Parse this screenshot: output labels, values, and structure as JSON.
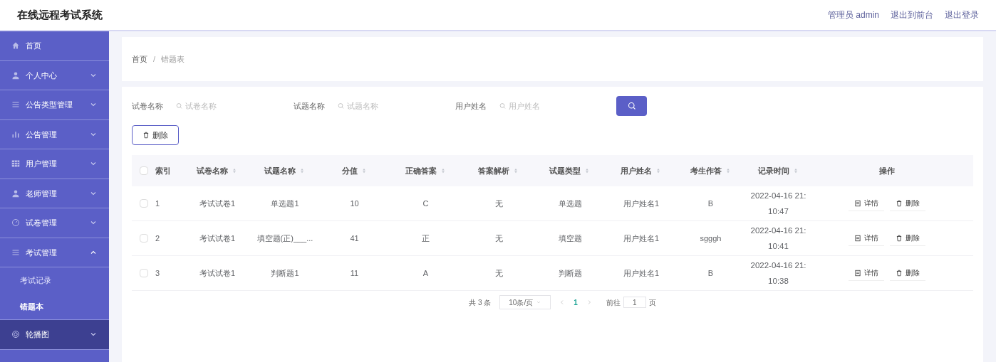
{
  "header": {
    "title": "在线远程考试系统",
    "links": [
      "管理员 admin",
      "退出到前台",
      "退出登录"
    ]
  },
  "sidebar": {
    "items": [
      {
        "label": "首页",
        "kind": "link",
        "selected": false
      },
      {
        "label": "个人中心",
        "kind": "menu",
        "expanded": false,
        "selected": false
      },
      {
        "label": "公告类型管理",
        "kind": "menu",
        "expanded": false,
        "selected": false
      },
      {
        "label": "公告管理",
        "kind": "menu",
        "expanded": false,
        "selected": false
      },
      {
        "label": "用户管理",
        "kind": "menu",
        "expanded": false,
        "selected": false
      },
      {
        "label": "老师管理",
        "kind": "menu",
        "expanded": false,
        "selected": false
      },
      {
        "label": "试卷管理",
        "kind": "menu",
        "expanded": false,
        "selected": false
      },
      {
        "label": "考试管理",
        "kind": "menu",
        "expanded": true,
        "selected": false,
        "children": [
          {
            "label": "考试记录",
            "selected": false
          },
          {
            "label": "错题本",
            "selected": true
          }
        ]
      },
      {
        "label": "轮播图",
        "kind": "menu",
        "expanded": false,
        "selected": true
      }
    ]
  },
  "breadcrumb": {
    "items": [
      "首页",
      "错题表"
    ],
    "separator": "/"
  },
  "search": {
    "fields": [
      {
        "label": "试卷名称",
        "placeholder": "试卷名称"
      },
      {
        "label": "试题名称",
        "placeholder": "试题名称"
      },
      {
        "label": "用户姓名",
        "placeholder": "用户姓名"
      }
    ]
  },
  "delete_button": "删除",
  "table": {
    "all_checked": false,
    "columns": [
      {
        "label": "索引",
        "sortable": false
      },
      {
        "label": "试卷名称",
        "sortable": true
      },
      {
        "label": "试题名称",
        "sortable": true
      },
      {
        "label": "分值",
        "sortable": true
      },
      {
        "label": "正确答案",
        "sortable": true
      },
      {
        "label": "答案解析",
        "sortable": true
      },
      {
        "label": "试题类型",
        "sortable": true
      },
      {
        "label": "用户姓名",
        "sortable": true
      },
      {
        "label": "考生作答",
        "sortable": true
      },
      {
        "label": "记录时间",
        "sortable": true
      },
      {
        "label": "操作",
        "sortable": false
      }
    ],
    "rows": [
      {
        "checked": false,
        "cells": [
          "1",
          "考试试卷1",
          "单选题1",
          "10",
          "C",
          "无",
          "单选题",
          "用户姓名1",
          "B",
          "2022-04-16 21:10:47"
        ],
        "actions": [
          "详情",
          "删除"
        ]
      },
      {
        "checked": false,
        "cells": [
          "2",
          "考试试卷1",
          "填空题(正)___...",
          "41",
          "正",
          "无",
          "填空题",
          "用户姓名1",
          "sgggh",
          "2022-04-16 21:10:41"
        ],
        "actions": [
          "详情",
          "删除"
        ]
      },
      {
        "checked": false,
        "cells": [
          "3",
          "考试试卷1",
          "判断题1",
          "11",
          "A",
          "无",
          "判断题",
          "用户姓名1",
          "B",
          "2022-04-16 21:10:38"
        ],
        "actions": [
          "详情",
          "删除"
        ]
      }
    ]
  },
  "pagination": {
    "total": "共 3 条",
    "page_size": "10条/页",
    "pages": [
      {
        "label": "1",
        "selected": true
      }
    ],
    "goto_label": "前往",
    "goto_value": "1",
    "goto_suffix": "页"
  }
}
